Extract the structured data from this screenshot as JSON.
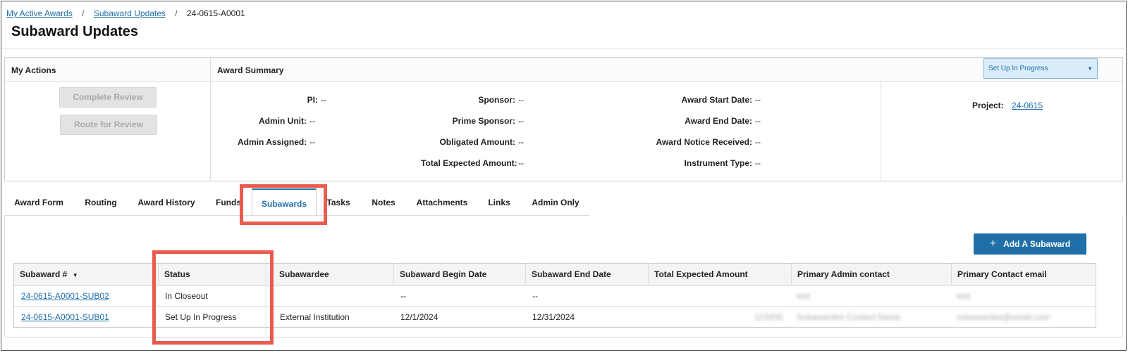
{
  "breadcrumb": {
    "items": [
      "My Active Awards",
      "Subaward Updates"
    ],
    "current": "24-0615-A0001",
    "separator": "/"
  },
  "page_title": "Subaward Updates",
  "my_actions": {
    "title": "My Actions",
    "buttons": [
      "Complete Review",
      "Route for Review"
    ]
  },
  "award_summary": {
    "title": "Award Summary",
    "status_select": "Set Up In Progress",
    "col1": [
      {
        "label": "PI:",
        "value": "--"
      },
      {
        "label": "Admin Unit:",
        "value": "--"
      },
      {
        "label": "Admin Assigned:",
        "value": "--"
      }
    ],
    "col2": [
      {
        "label": "Sponsor:",
        "value": "--"
      },
      {
        "label": "Prime Sponsor:",
        "value": "--"
      },
      {
        "label": "Obligated Amount:",
        "value": "--"
      },
      {
        "label": "Total Expected Amount:",
        "value": "--"
      }
    ],
    "col3": [
      {
        "label": "Award Start Date:",
        "value": "--"
      },
      {
        "label": "Award End Date:",
        "value": "--"
      },
      {
        "label": "Award Notice Received:",
        "value": "--"
      },
      {
        "label": "Instrument Type:",
        "value": "--"
      }
    ],
    "project_label": "Project:",
    "project_value": "24-0615"
  },
  "tabs": [
    "Award Form",
    "Routing",
    "Award History",
    "Funds",
    "Subawards",
    "Tasks",
    "Notes",
    "Attachments",
    "Links",
    "Admin Only"
  ],
  "active_tab": "Subawards",
  "add_button": "Add A Subaward",
  "table": {
    "headers": [
      "Subaward #",
      "Status",
      "Subawardee",
      "Subaward Begin Date",
      "Subaward End Date",
      "Total Expected Amount",
      "Primary Admin contact",
      "Primary Contact email"
    ],
    "rows": [
      [
        "24-0615-A0001-SUB02",
        "In Closeout",
        "",
        "--",
        "--",
        "",
        "test",
        "test"
      ],
      [
        "24-0615-A0001-SUB01",
        "Set Up In Progress",
        "External Institution",
        "12/1/2024",
        "12/31/2024",
        "123456",
        "Subawardee Contact Name",
        "subawardee@email.com"
      ]
    ]
  },
  "colors": {
    "link": "#1f6fa8",
    "highlight": "#e95b4c",
    "primary_button": "#1f6fa8"
  }
}
